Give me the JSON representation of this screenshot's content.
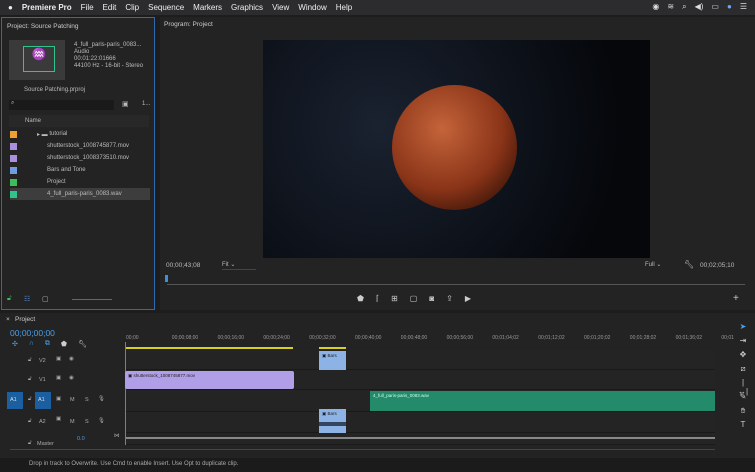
{
  "menubar": {
    "app": "Premiere Pro",
    "items": [
      "File",
      "Edit",
      "Clip",
      "Sequence",
      "Markers",
      "Graphics",
      "View",
      "Window",
      "Help"
    ]
  },
  "project": {
    "title": "Project: Source Patching",
    "preview": {
      "name": "4_full_paris-paris_0083...",
      "type": "Audio",
      "duration": "00:01:22:01666",
      "format": "44100 Hz - 16-bit - Stereo"
    },
    "file": "Source Patching.prproj",
    "count": "1...",
    "column": "Name",
    "items": [
      {
        "name": "tutorial",
        "color": "#f0a030"
      },
      {
        "name": "shutterstock_1008745877.mov",
        "color": "#a98fdc"
      },
      {
        "name": "shutterstock_1008373510.mov",
        "color": "#a98fdc"
      },
      {
        "name": "Bars and Tone",
        "color": "#6f9de0"
      },
      {
        "name": "Project",
        "color": "#3cbf5a"
      },
      {
        "name": "4_full_paris-paris_0083.wav",
        "color": "#2fc58a"
      }
    ]
  },
  "program": {
    "title": "Program: Project",
    "timecode_in": "00;00;43;08",
    "fit": "Fit",
    "quality": "Full",
    "duration": "00;02;05;10"
  },
  "timeline": {
    "title": "Project",
    "timecode": "00;00;00;00",
    "ticks": [
      "00;00",
      "00;00;08;00",
      "00;00;16;00",
      "00;00;24;00",
      "00;00;32;00",
      "00;00;40;00",
      "00;00;48;00",
      "00;00;56;00",
      "00;01;04;02",
      "00;01;12;02",
      "00;01;20;02",
      "00;01;28;02",
      "00;01;36;02",
      "00;01"
    ],
    "tracks": {
      "v2": "V2",
      "v1": "V1",
      "a1_src": "A1",
      "a1": "A1",
      "a2": "A2",
      "master": "Master",
      "master_val": "0.0",
      "m": "M",
      "s": "S"
    },
    "clips": {
      "bars_v": "Bars",
      "shutter": "shutterstock_1008745877.mov",
      "wav": "4_full_paris-paris_0083.wav",
      "bars_a": "Bars"
    }
  },
  "status": "Drop in track to Overwrite. Use Cmd to enable Insert. Use Opt to duplicate clip."
}
